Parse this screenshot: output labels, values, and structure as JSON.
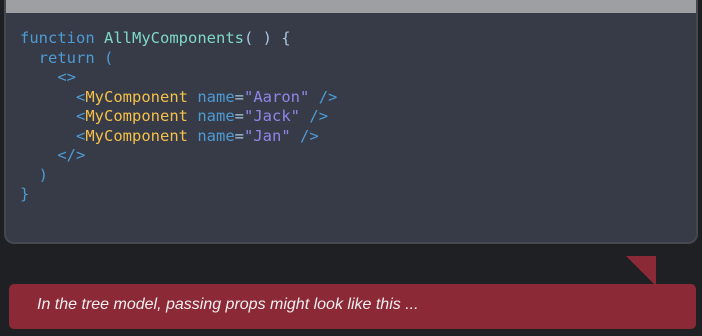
{
  "code": {
    "line1": {
      "kw": "function",
      "name": "AllMyComponents",
      "rest": "( ) {"
    },
    "line2": {
      "kw": "return",
      "rest": "("
    },
    "line3": {
      "open_fragment": "<>"
    },
    "items": [
      {
        "lt": "<",
        "tag": "MyComponent",
        "attr": "name",
        "eq": "=",
        "value": "\"Aaron\"",
        "close": "/>"
      },
      {
        "lt": "<",
        "tag": "MyComponent",
        "attr": "name",
        "eq": "=",
        "value": "\"Jack\"",
        "close": "/>"
      },
      {
        "lt": "<",
        "tag": "MyComponent",
        "attr": "name",
        "eq": "=",
        "value": "\"Jan\"",
        "close": "/>"
      }
    ],
    "line7": {
      "close_fragment": "</>"
    },
    "line8": {
      "paren": ")"
    },
    "line9": {
      "brace": "}"
    }
  },
  "caption": {
    "text": "In the tree model, passing props might look like this ..."
  },
  "colors": {
    "keyword": "#4e9bd4",
    "function_name": "#7fd8c8",
    "jsx_tag": "#f5c04a",
    "string": "#8f86e8",
    "caption_background": "#8b2a36",
    "code_background": "#363b47"
  }
}
